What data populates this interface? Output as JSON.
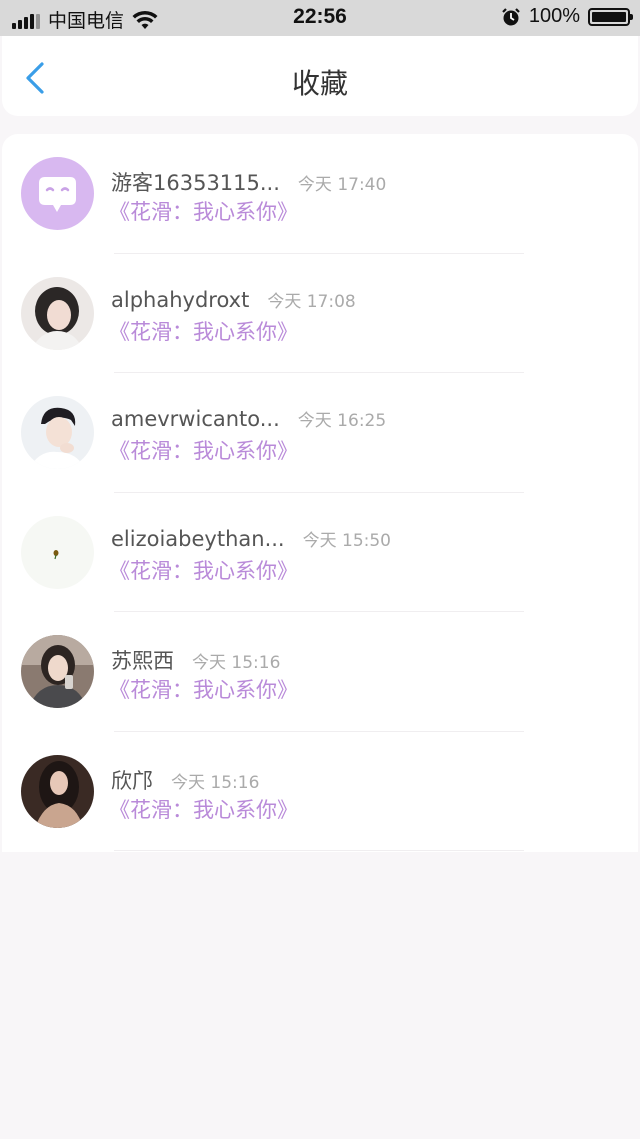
{
  "status_bar": {
    "carrier": "中国电信",
    "time": "22:56",
    "battery": "100%"
  },
  "header": {
    "title": "收藏"
  },
  "items": [
    {
      "name": "游客16353115...",
      "time": "今天 17:40",
      "subtitle": "《花滑：我心系你》",
      "avatar": "default-chat-avatar"
    },
    {
      "name": "alphahydroxt",
      "time": "今天 17:08",
      "subtitle": "《花滑：我心系你》",
      "avatar": "photo-avatar"
    },
    {
      "name": "amevrwicanto...",
      "time": "今天 16:25",
      "subtitle": "《花滑：我心系你》",
      "avatar": "photo-avatar"
    },
    {
      "name": "elizoiabeythan...",
      "time": "今天 15:50",
      "subtitle": "《花滑：我心系你》",
      "avatar": "photo-avatar"
    },
    {
      "name": "苏熙西",
      "time": "今天 15:16",
      "subtitle": "《花滑：我心系你》",
      "avatar": "photo-avatar"
    },
    {
      "name": "欣邝",
      "time": "今天 15:16",
      "subtitle": "《花滑：我心系你》",
      "avatar": "photo-avatar"
    }
  ],
  "colors": {
    "accent": "#b98ad9",
    "back_arrow": "#3a9ee8",
    "background": "#f8f6f8"
  }
}
